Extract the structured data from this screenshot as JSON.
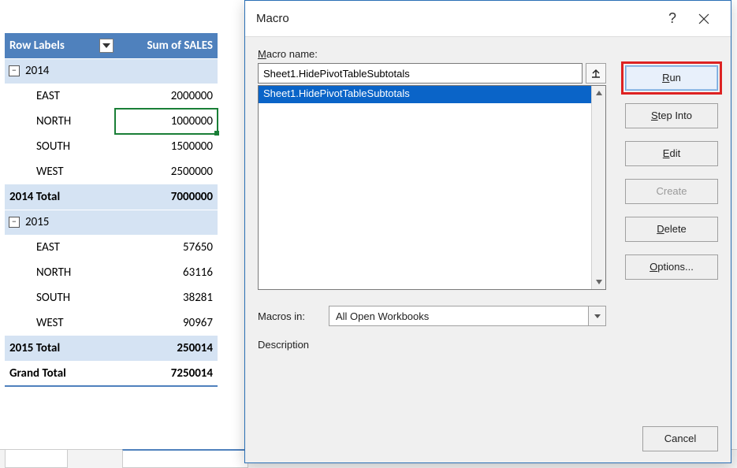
{
  "pivot": {
    "headers": {
      "col1": "Row Labels",
      "col2": "Sum of SALES"
    },
    "groups": [
      {
        "label": "2014",
        "items": [
          {
            "region": "EAST",
            "value": "2000000"
          },
          {
            "region": "NORTH",
            "value": "1000000"
          },
          {
            "region": "SOUTH",
            "value": "1500000"
          },
          {
            "region": "WEST",
            "value": "2500000"
          }
        ],
        "subtotal_label": "2014 Total",
        "subtotal_value": "7000000"
      },
      {
        "label": "2015",
        "items": [
          {
            "region": "EAST",
            "value": "57650"
          },
          {
            "region": "NORTH",
            "value": "63116"
          },
          {
            "region": "SOUTH",
            "value": "38281"
          },
          {
            "region": "WEST",
            "value": "90967"
          }
        ],
        "subtotal_label": "2015 Total",
        "subtotal_value": "250014"
      }
    ],
    "grand_label": "Grand Total",
    "grand_value": "7250014"
  },
  "dialog": {
    "title": "Macro",
    "help_symbol": "?",
    "macro_name_label_pre": "M",
    "macro_name_label_post": "acro name:",
    "macro_name_value": "Sheet1.HidePivotTableSubtotals",
    "list_item": "Sheet1.HidePivotTableSubtotals",
    "macros_in_label_pre": "M",
    "macros_in_label_post": "acros in:",
    "macros_in_value": "All Open Workbooks",
    "description_label": "Description",
    "buttons": {
      "run_pre": "R",
      "run_post": "un",
      "step_pre": "S",
      "step_post": "tep Into",
      "edit_pre": "E",
      "edit_post": "dit",
      "create": "Create",
      "delete_pre": "D",
      "delete_post": "elete",
      "options_pre": "O",
      "options_post": "ptions...",
      "cancel": "Cancel"
    }
  }
}
